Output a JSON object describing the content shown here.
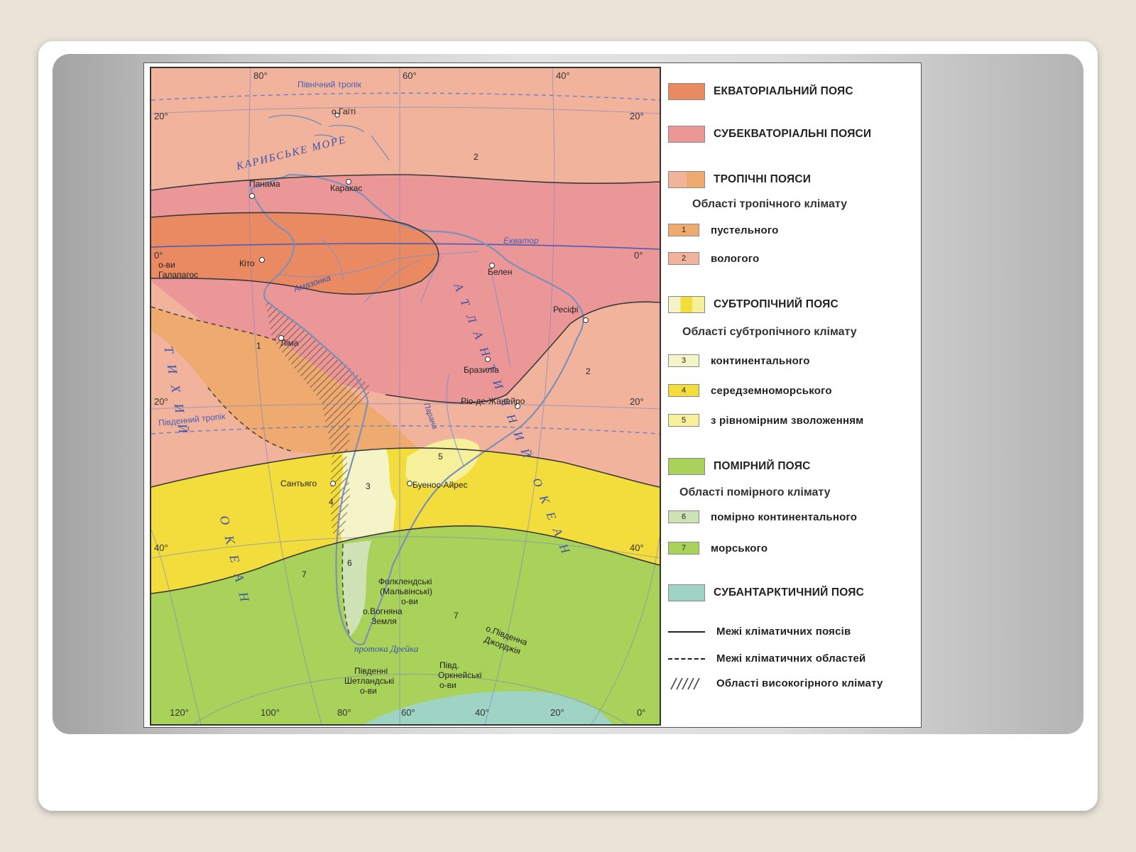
{
  "map": {
    "longitudes_top": [
      "80°",
      "60°",
      "40°"
    ],
    "longitudes_bottom": [
      "120°",
      "100°",
      "80°",
      "60°",
      "40°",
      "20°",
      "0°"
    ],
    "latitudes_left": [
      "20°",
      "0°",
      "20°",
      "40°"
    ],
    "latitudes_right": [
      "20°",
      "0°",
      "20°",
      "40°"
    ],
    "lines": {
      "north_tropic": "Північний тропік",
      "south_tropic": "Південний тропік",
      "equator": "Екватор"
    },
    "seas": {
      "caribbean": "КАРИБСЬКЕ МОРЕ",
      "atlantic": "АТЛАНТИЧНИЙ ОКЕАН",
      "pacific_top": "ТИХИЙ",
      "pacific_bottom": "ОКЕАН",
      "drake": "протока Дрейка",
      "amazon": "Амазонка",
      "parana": "Парана"
    },
    "places": {
      "haiti": "о.Гаїті",
      "panama": "Панама",
      "caracas": "Каракас",
      "quito": "Кіто",
      "galapagos_1": "о-ви",
      "galapagos_2": "Галапагос",
      "belem": "Белен",
      "recife": "Ресіфі",
      "lima": "Ліма",
      "brasilia": "Бразиліа",
      "rio": "Ріо-де-Жанейро",
      "santiago": "Сантьяго",
      "buenos_aires": "Буенос-Айрес",
      "falklands_1": "Фолклендські",
      "falklands_2": "(Мальвінські)",
      "falklands_3": "о-ви",
      "tierra_1": "о.Вогняна",
      "tierra_2": "Земля",
      "s_georgia_1": "о.Південна",
      "s_georgia_2": "Джорджія",
      "s_shetland_1": "Південні",
      "s_shetland_2": "Шетландські",
      "s_shetland_3": "о-ви",
      "s_orkney_1": "Півд.",
      "s_orkney_2": "Оркнейські",
      "s_orkney_3": "о-ви"
    },
    "region_numbers": [
      "1",
      "2",
      "2",
      "3",
      "4",
      "5",
      "6",
      "7",
      "7"
    ]
  },
  "legend": {
    "equatorial": "ЕКВАТОРІАЛЬНИЙ ПОЯС",
    "subequatorial": "СУБЕКВАТОРІАЛЬНІ ПОЯСИ",
    "tropical": "ТРОПІЧНІ ПОЯСИ",
    "tropical_regions": "Області тропічного клімату",
    "t1_num": "1",
    "t1": "пустельного",
    "t2_num": "2",
    "t2": "вологого",
    "subtropical": "СУБТРОПІЧНИЙ ПОЯС",
    "subtropical_regions": "Області субтропічного клімату",
    "s3_num": "3",
    "s3": "континентального",
    "s4_num": "4",
    "s4": "середземноморського",
    "s5_num": "5",
    "s5": "з рівномірним зволоженням",
    "temperate": "ПОМІРНИЙ ПОЯС",
    "temperate_regions": "Області помірного клімату",
    "m6_num": "6",
    "m6": "помірно континентального",
    "m7_num": "7",
    "m7": "морського",
    "subantarctic": "СУБАНТАРКТИЧНИЙ ПОЯС",
    "belt_borders": "Межі кліматичних поясів",
    "region_borders": "Межі кліматичних областей",
    "highland": "Області високогірного клімату"
  },
  "colors": {
    "equatorial": "#ea8a63",
    "subequatorial": "#ec9797",
    "tropical_wet": "#f2b39c",
    "tropical_desert": "#eeaa6f",
    "subtropical_cont": "#f4f4c8",
    "subtropical_med": "#f3dd3c",
    "subtropical_humid": "#f6f09a",
    "temperate_cont": "#cfe2b6",
    "temperate_sea": "#a9d25a",
    "subantarctic": "#9fd3c4"
  }
}
